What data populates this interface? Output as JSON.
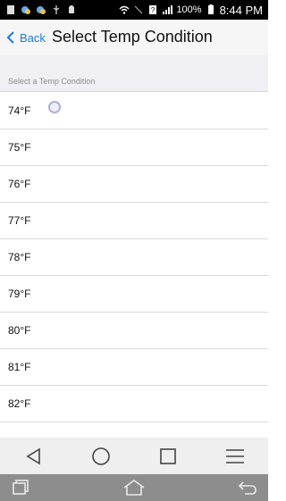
{
  "status_bar": {
    "battery": "100%",
    "time": "8:44 PM"
  },
  "navbar": {
    "back_label": "Back",
    "title": "Select Temp Condition"
  },
  "section": {
    "header": "Select a Temp Condition"
  },
  "list": {
    "items": [
      "74°F",
      "75°F",
      "76°F",
      "77°F",
      "78°F",
      "79°F",
      "80°F",
      "81°F",
      "82°F"
    ]
  },
  "icons": {
    "app_keys": [
      "back-triangle-icon",
      "home-circle-icon",
      "recents-square-icon",
      "menu-icon"
    ],
    "system_keys": [
      "recent-apps-icon",
      "home-icon",
      "back-arrow-icon"
    ]
  },
  "colors": {
    "accent": "#1f7ae0",
    "status_bar": "#000000",
    "system_bar": "#8d8d8d"
  }
}
